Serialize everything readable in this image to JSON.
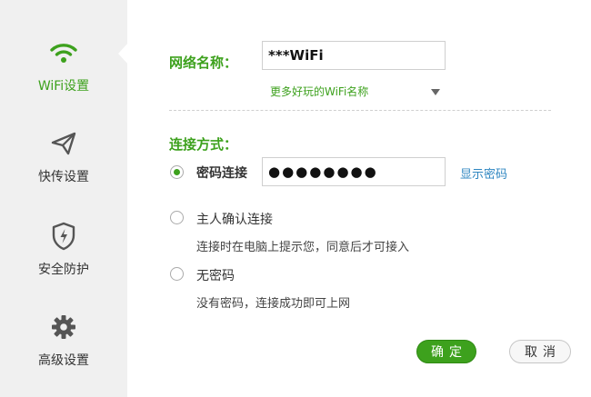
{
  "sidebar": {
    "items": [
      {
        "label": "WiFi设置",
        "icon": "wifi-icon",
        "active": true
      },
      {
        "label": "快传设置",
        "icon": "paper-plane-icon",
        "active": false
      },
      {
        "label": "安全防护",
        "icon": "shield-icon",
        "active": false
      },
      {
        "label": "高级设置",
        "icon": "gear-icon",
        "active": false
      }
    ]
  },
  "wifi": {
    "ssid_label": "网络名称：",
    "ssid_value": "***WiFi",
    "more_names_link": "更多好玩的WiFi名称",
    "connection_label": "连接方式：",
    "options": [
      {
        "label": "密码连接",
        "selected": true,
        "description": ""
      },
      {
        "label": "主人确认连接",
        "selected": false,
        "description": "连接时在电脑上提示您，同意后才可接入"
      },
      {
        "label": "无密码",
        "selected": false,
        "description": "没有密码，连接成功即可上网"
      }
    ],
    "password_masked": "●●●●●●●●",
    "show_password_link": "显示密码"
  },
  "buttons": {
    "ok": "确定",
    "cancel": "取消"
  },
  "colors": {
    "accent": "#3da11d",
    "link_blue": "#2e86c1",
    "sidebar_bg": "#f0f0f0"
  }
}
